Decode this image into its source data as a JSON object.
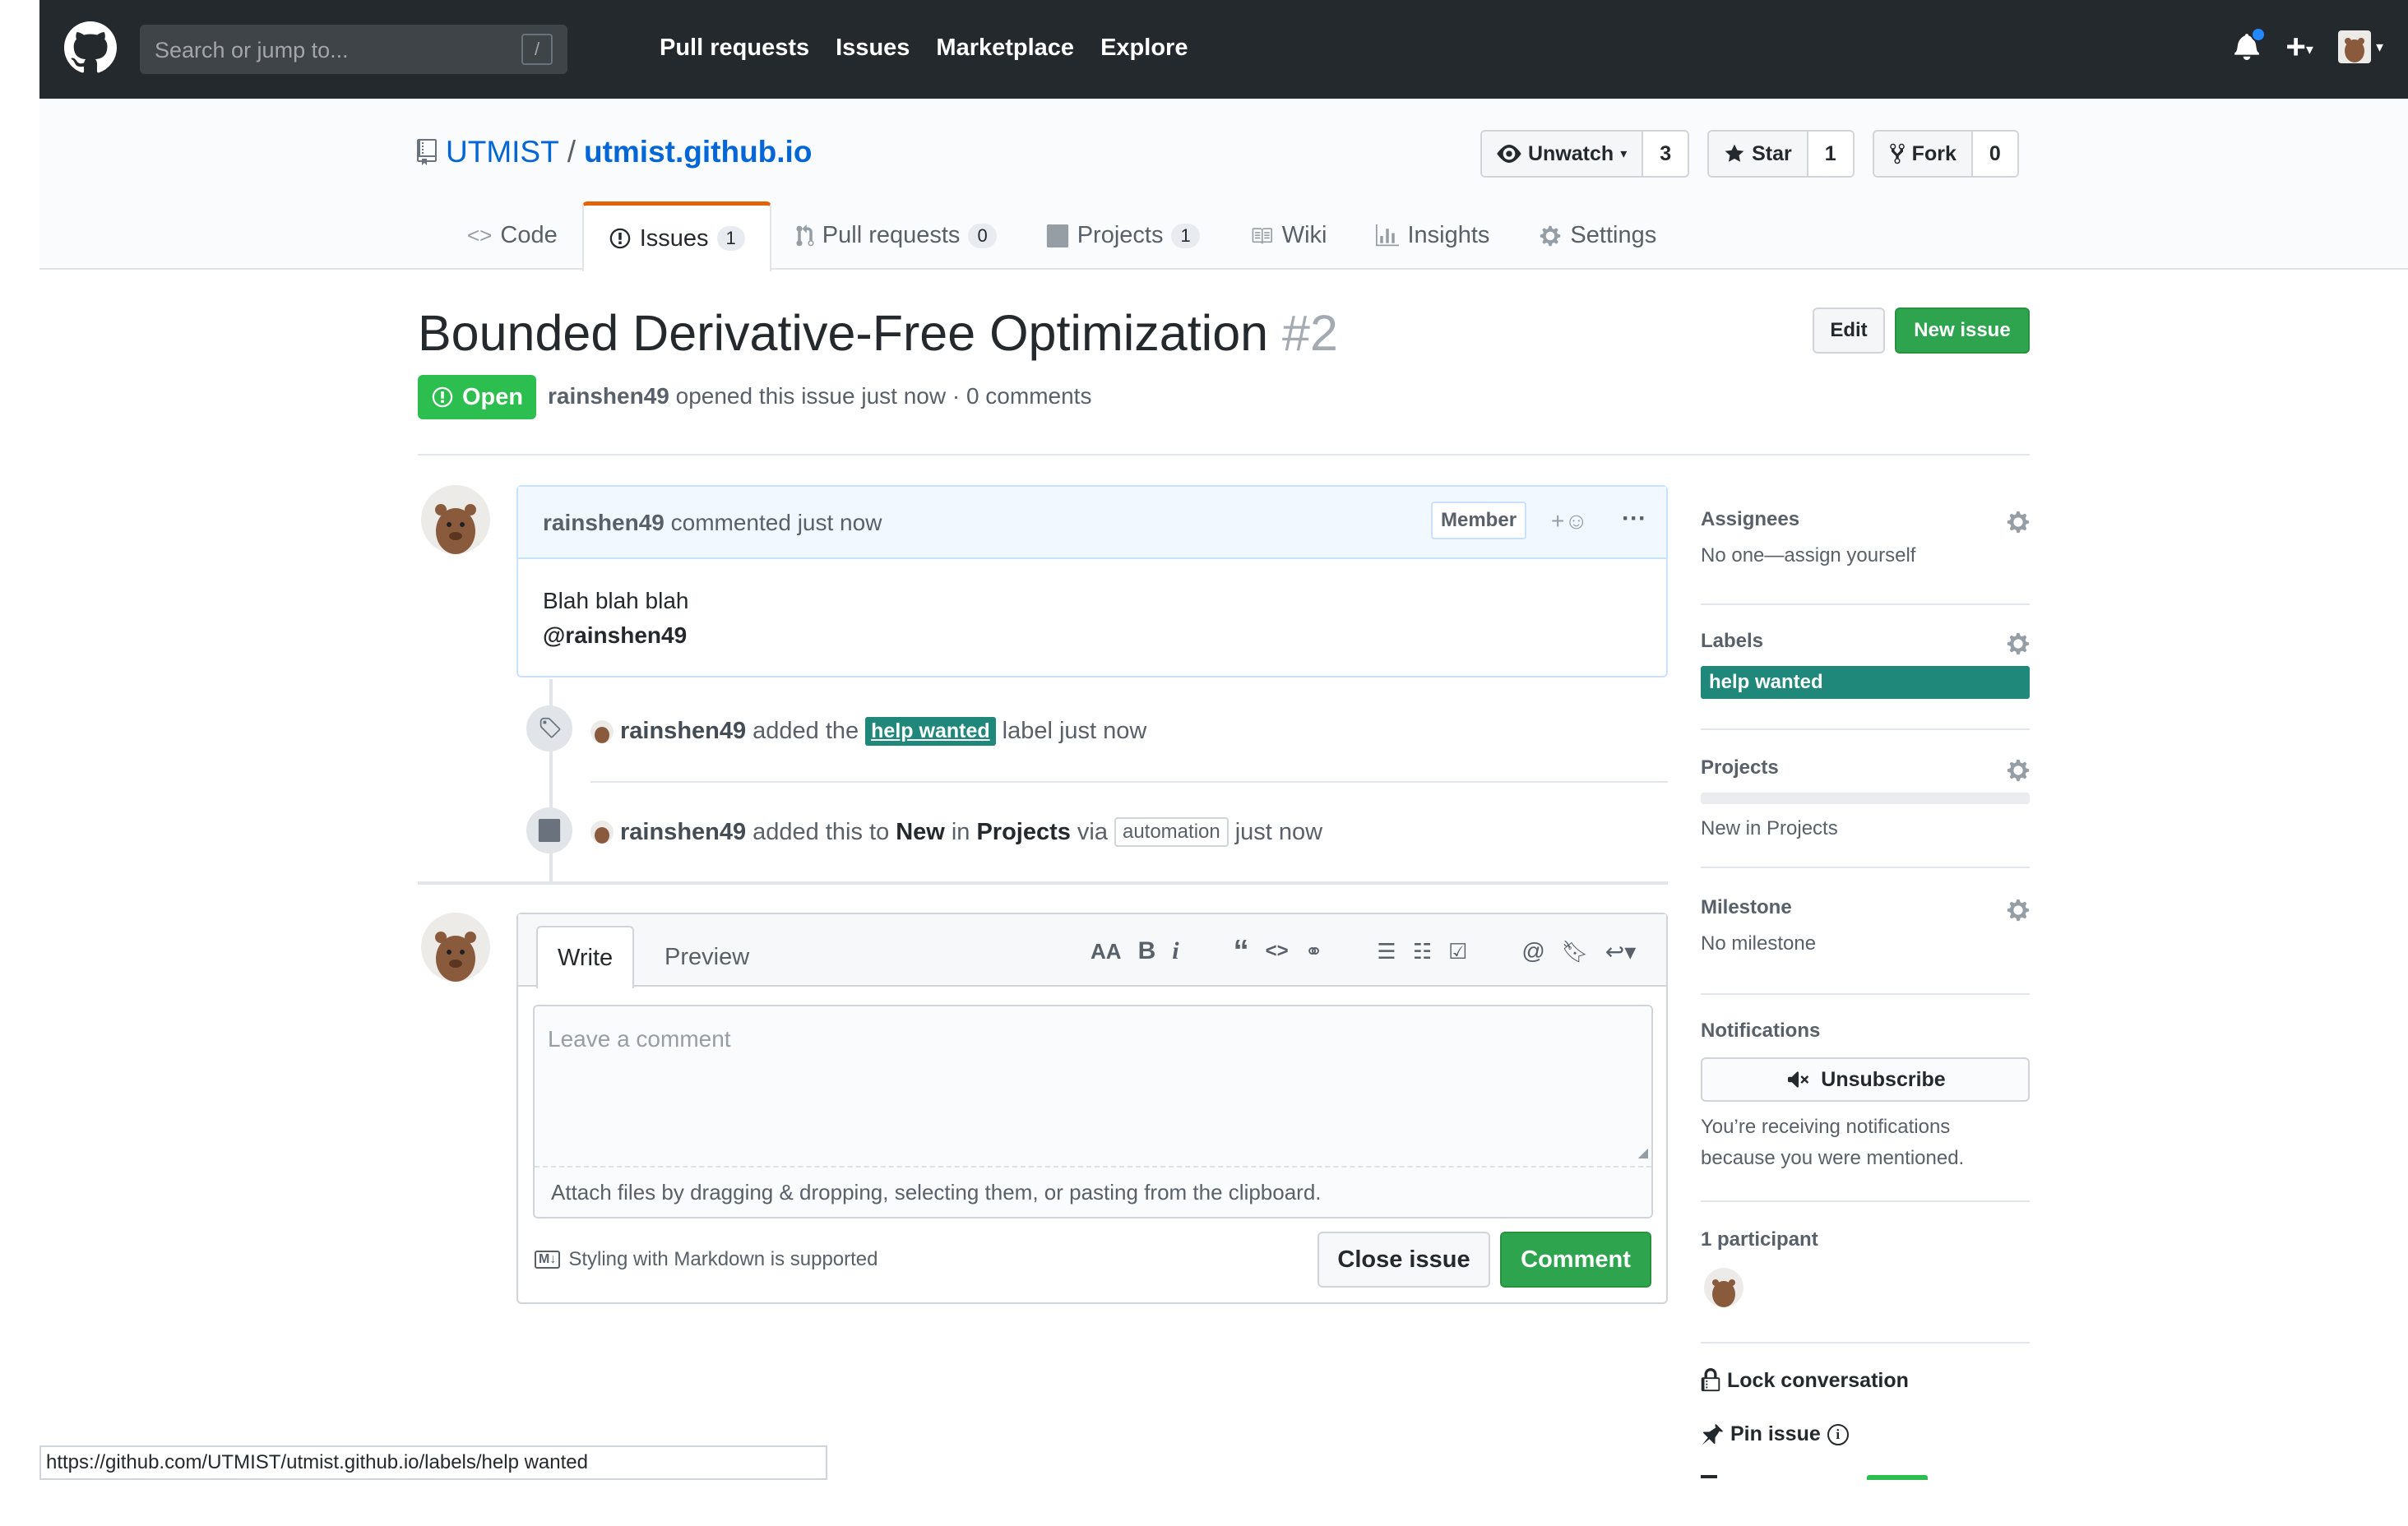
{
  "header": {
    "search_placeholder": "Search or jump to...",
    "search_shortcut": "/",
    "nav": [
      "Pull requests",
      "Issues",
      "Marketplace",
      "Explore"
    ]
  },
  "repo": {
    "owner": "UTMIST",
    "separator": "/",
    "name": "utmist.github.io",
    "watch": {
      "label": "Unwatch",
      "count": "3"
    },
    "star": {
      "label": "Star",
      "count": "1"
    },
    "fork": {
      "label": "Fork",
      "count": "0"
    },
    "tabs": [
      {
        "label": "Code",
        "count": "",
        "icon": "code-icon"
      },
      {
        "label": "Issues",
        "count": "1",
        "icon": "issue-icon"
      },
      {
        "label": "Pull requests",
        "count": "0",
        "icon": "pr-icon"
      },
      {
        "label": "Projects",
        "count": "1",
        "icon": "project-icon"
      },
      {
        "label": "Wiki",
        "count": "",
        "icon": "book-icon"
      },
      {
        "label": "Insights",
        "count": "",
        "icon": "graph-icon"
      },
      {
        "label": "Settings",
        "count": "",
        "icon": "gear-icon"
      }
    ]
  },
  "issue": {
    "title": "Bounded Derivative-Free Optimization",
    "number": "#2",
    "edit_label": "Edit",
    "new_issue_label": "New issue",
    "state": "Open",
    "author": "rainshen49",
    "meta": "opened this issue just now · 0 comments"
  },
  "comment": {
    "author": "rainshen49",
    "action": "commented just now",
    "badge": "Member",
    "body_line1": "Blah blah blah",
    "body_line2": "@rainshen49"
  },
  "timeline": {
    "label_event": {
      "author": "rainshen49",
      "pre": "added the",
      "label": "help wanted",
      "post": "label just now"
    },
    "project_event": {
      "author": "rainshen49",
      "pre": "added this to",
      "column": "New",
      "in": "in",
      "project": "Projects",
      "via": "via",
      "automation": "automation",
      "post": "just now"
    }
  },
  "compose": {
    "tab_write": "Write",
    "tab_preview": "Preview",
    "placeholder": "Leave a comment",
    "attach_text": "Attach files by dragging & dropping, selecting them, or pasting from the clipboard.",
    "markdown_note": "Styling with Markdown is supported",
    "close_label": "Close issue",
    "comment_label": "Comment",
    "toolbar": {
      "heading": "AA",
      "bold": "B",
      "italic": "i"
    }
  },
  "sidebar": {
    "assignees": {
      "heading": "Assignees",
      "value": "No one—assign yourself"
    },
    "labels": {
      "heading": "Labels",
      "value": "help wanted"
    },
    "projects": {
      "heading": "Projects",
      "value": "New in Projects"
    },
    "milestone": {
      "heading": "Milestone",
      "value": "No milestone"
    },
    "notifications": {
      "heading": "Notifications",
      "button": "Unsubscribe",
      "text1": "You’re receiving notifications",
      "text2": "because you were mentioned."
    },
    "participants": {
      "heading": "1 participant"
    },
    "lock": "Lock conversation",
    "pin": "Pin issue"
  },
  "statusbar": {
    "url": "https://github.com/UTMIST/utmist.github.io/labels/help wanted"
  },
  "colors": {
    "open_green": "#2cbe4e",
    "label_teal": "#20887a",
    "accent_orange": "#e36209",
    "link_blue": "#0366d6"
  }
}
